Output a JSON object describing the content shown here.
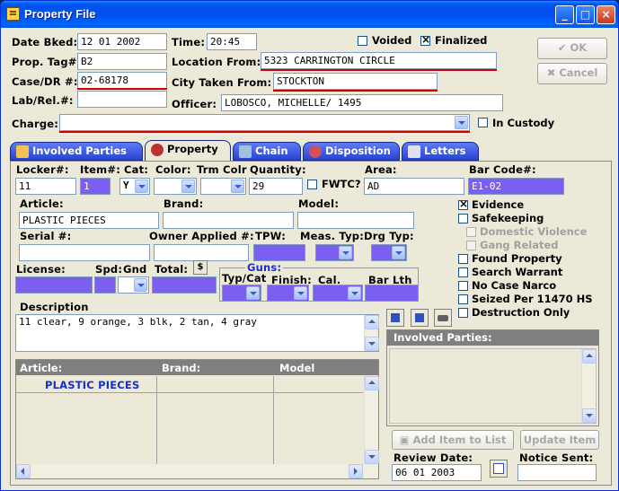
{
  "window": {
    "title": "Property File"
  },
  "header": {
    "date_booked_label": "Date Bked:",
    "date_booked": "12 01 2002",
    "time_label": "Time:",
    "time": "20:45",
    "voided_label": "Voided",
    "voided": false,
    "finalized_label": "Finalized",
    "finalized": true,
    "prop_tag_label": "Prop. Tag#:",
    "prop_tag": "B2",
    "location_from_label": "Location From:",
    "location_from": "5323 CARRINGTON CIRCLE",
    "case_dr_label": "Case/DR #:",
    "case_dr": "02-68178",
    "city_taken_label": "City Taken From:",
    "city_taken": "STOCKTON",
    "lab_rel_label": "Lab/Rel.#:",
    "lab_rel": "",
    "officer_label": "Officer:",
    "officer": "LOBOSCO, MICHELLE/ 1495",
    "charge_label": "Charge:",
    "charge": "",
    "in_custody_label": "In Custody",
    "in_custody": false
  },
  "buttons": {
    "ok": "OK",
    "cancel": "Cancel",
    "add_item": "Add Item to List",
    "update_item": "Update Item"
  },
  "tabs": [
    {
      "label": "Involved Parties",
      "active": false
    },
    {
      "label": "Property",
      "active": true
    },
    {
      "label": "Chain",
      "active": false
    },
    {
      "label": "Disposition",
      "active": false
    },
    {
      "label": "Letters",
      "active": false
    }
  ],
  "property": {
    "locker_label": "Locker#:",
    "locker": "11",
    "item_label": "Item#:",
    "item": "1",
    "cat_label": "Cat:",
    "cat": "Y",
    "color_label": "Color:",
    "color": "",
    "trm_colr_label": "Trm Colr",
    "trm_colr": "",
    "quantity_label": "Quantity:",
    "quantity": "29",
    "fwtc_label": "FWTC?",
    "fwtc": false,
    "area_label": "Area:",
    "area": "AD",
    "bar_code_label": "Bar Code#:",
    "bar_code": "E1-02",
    "article_label": "Article:",
    "article": "PLASTIC PIECES",
    "brand_label": "Brand:",
    "brand": "",
    "model_label": "Model:",
    "model": "",
    "serial_label": "Serial #:",
    "serial": "",
    "owner_applied_label": "Owner Applied #:",
    "owner_applied": "",
    "tpw_label": "TPW:",
    "tpw": "",
    "meas_typ_label": "Meas. Typ:",
    "meas_typ": "",
    "drg_typ_label": "Drg Typ:",
    "drg_typ": "",
    "license_label": "License:",
    "license": "",
    "spd_label": "Spd:",
    "gnd_label": "Gnd",
    "total_label": "Total:",
    "dollar_symbol": "$",
    "guns_label": "Guns:",
    "typ_cat_label": "Typ/Cat",
    "finish_label": "Finish:",
    "cal_label": "Cal.",
    "bar_lth_label": "Bar Lth",
    "description_label": "Description",
    "description": "11 clear, 9 orange, 3 blk, 2 tan, 4 gray"
  },
  "flags": [
    {
      "label": "Evidence",
      "checked": true,
      "disabled": false
    },
    {
      "label": "Safekeeping",
      "checked": false,
      "disabled": false
    },
    {
      "label": "Domestic Violence",
      "checked": false,
      "disabled": true
    },
    {
      "label": "Gang Related",
      "checked": false,
      "disabled": true
    },
    {
      "label": "Found Property",
      "checked": false,
      "disabled": false
    },
    {
      "label": "Search Warrant",
      "checked": false,
      "disabled": false
    },
    {
      "label": "No Case Narco",
      "checked": false,
      "disabled": false
    },
    {
      "label": "Seized Per 11470 HS",
      "checked": false,
      "disabled": false
    },
    {
      "label": "Destruction Only",
      "checked": false,
      "disabled": false
    }
  ],
  "grid": {
    "columns": [
      "Article:",
      "Brand:",
      "Model"
    ],
    "rows": [
      {
        "article": "PLASTIC PIECES",
        "brand": "",
        "model": ""
      }
    ]
  },
  "involved_parties": {
    "title": "Involved Parties:"
  },
  "review": {
    "review_date_label": "Review Date:",
    "review_date": "06 01 2003",
    "notice_sent_label": "Notice Sent:",
    "notice_sent": ""
  },
  "colors": {
    "accent_purple": "#7a5ff0",
    "required_red": "#d00000",
    "label_blue": "#1530d0"
  }
}
